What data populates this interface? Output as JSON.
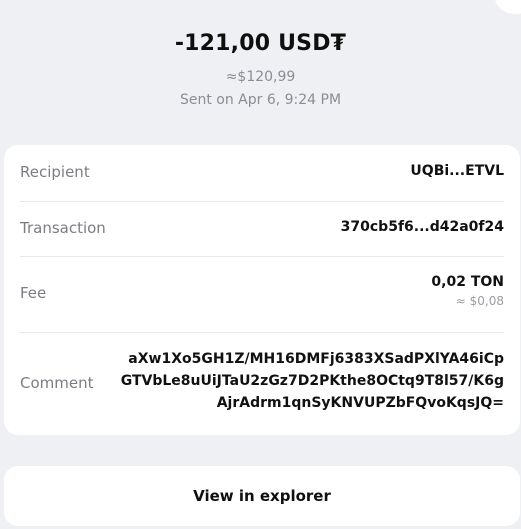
{
  "header": {
    "amount": "-121,00 USD₮",
    "approx_value": "≈$120,99",
    "sent_info": "Sent on Apr 6, 9:24 PM"
  },
  "details": {
    "recipient": {
      "label": "Recipient",
      "value": "UQBi...ETVL"
    },
    "transaction": {
      "label": "Transaction",
      "value": "370cb5f6...d42a0f24"
    },
    "fee": {
      "label": "Fee",
      "value": "0,02 TON",
      "sub": "≈ $0,08"
    },
    "comment": {
      "label": "Comment",
      "value": "aXw1Xo5GH1Z/MH16DMFj6383XSadPXlYA46iCpGTVbLe8uUiJTaU2zGz7D2PKthe8OCtq9T8l57/K6gAjrAdrm1qnSyKNVUPZbFQvoKqsJQ="
    }
  },
  "actions": {
    "explorer_label": "View in explorer"
  }
}
